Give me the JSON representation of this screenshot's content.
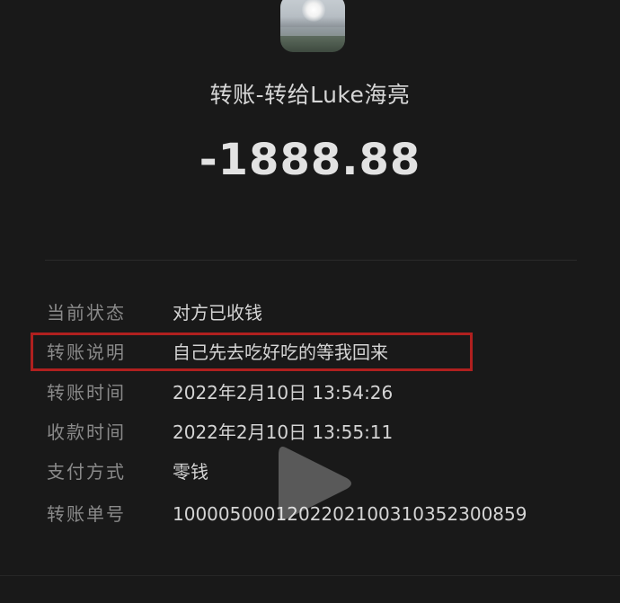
{
  "header": {
    "avatar_icon": "profile-avatar-lake-sunset",
    "title": "转账-转给Luke海亮",
    "amount": "-1888.88"
  },
  "details": {
    "rows": [
      {
        "label": "当前状态",
        "value": "对方已收钱"
      },
      {
        "label": "转账说明",
        "value": "自己先去吃好吃的等我回来"
      },
      {
        "label": "转账时间",
        "value": "2022年2月10日 13:54:26"
      },
      {
        "label": "收款时间",
        "value": "2022年2月10日 13:55:11"
      },
      {
        "label": "支付方式",
        "value": "零钱"
      },
      {
        "label": "转账单号",
        "value": "1000050001202202100310352300859"
      }
    ]
  },
  "overlay": {
    "play_icon": "play-icon",
    "highlight_color": "#b0201f"
  }
}
